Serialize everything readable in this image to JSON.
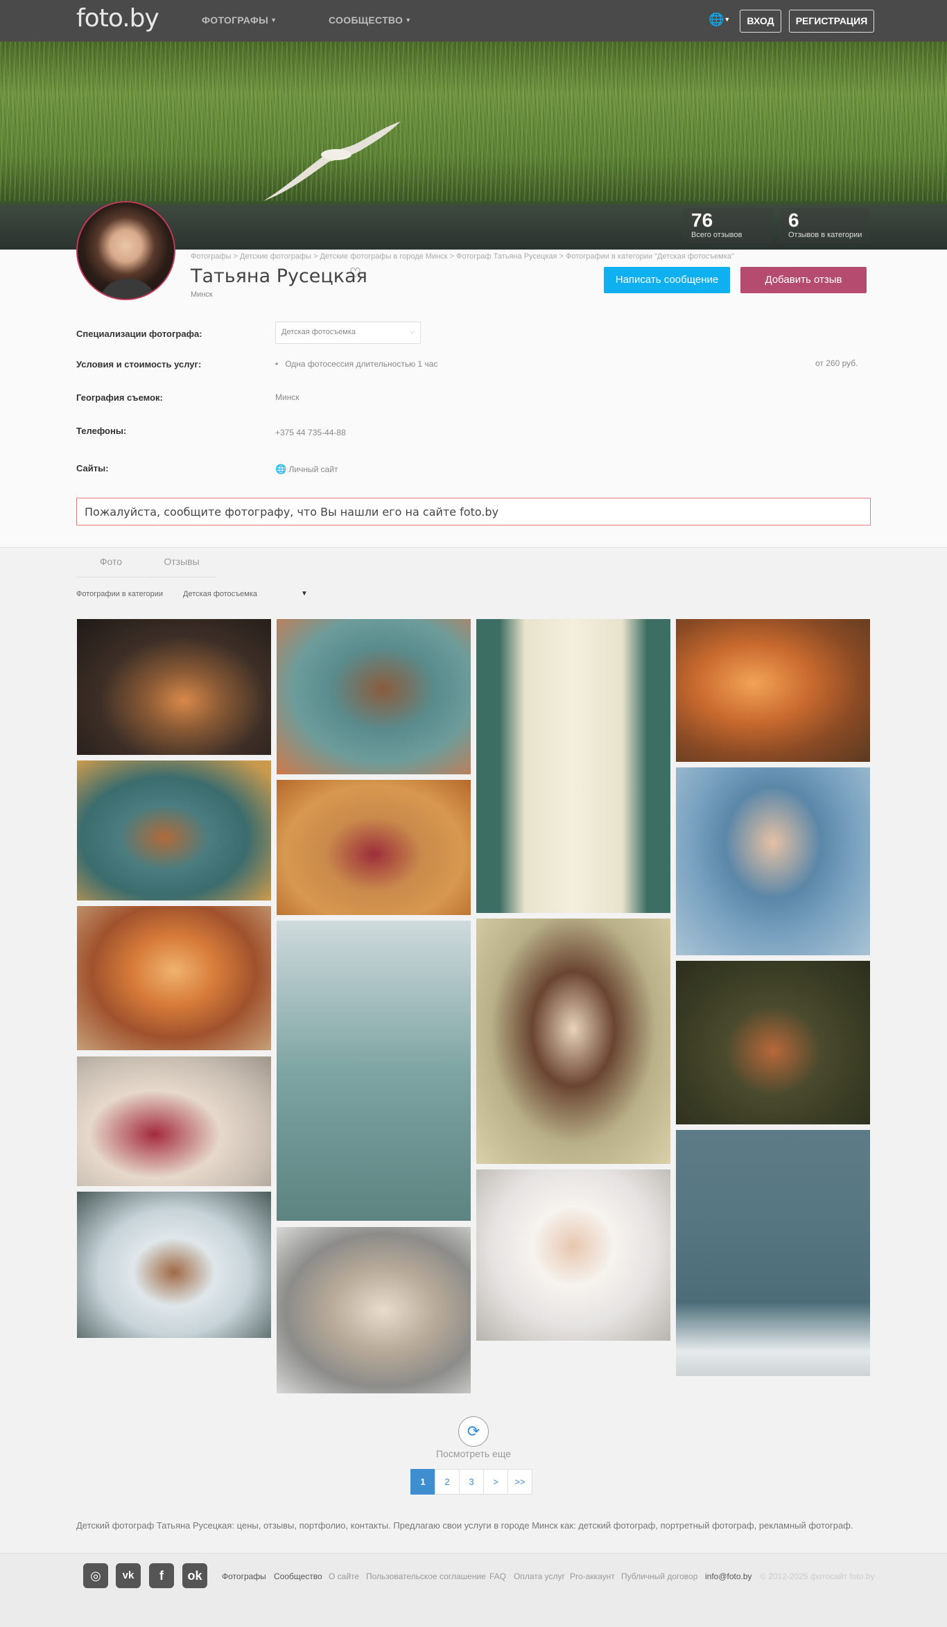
{
  "header": {
    "logo": "foto.by",
    "nav": [
      {
        "label": "ФОТОГРАФЫ"
      },
      {
        "label": "СООБЩЕСТВО"
      }
    ],
    "login_label": "ВХОД",
    "register_label": "РЕГИСТРАЦИЯ"
  },
  "hero": {
    "stats": [
      {
        "value": "76",
        "label": "Всего отзывов"
      },
      {
        "value": "6",
        "label": "Отзывов в категории"
      }
    ]
  },
  "profile": {
    "breadcrumb": "Фотографы > Детские фотографы > Детские фотографы в городе Минск > Фотограф Татьяна Русецкая > Фотографии в категории \"Детская фотосъемка\"",
    "name": "Татьяна Русецкая",
    "city": "Минск",
    "message_button": "Написать сообщение",
    "review_button": "Добавить отзыв"
  },
  "info": {
    "spec_label": "Специализации фотографа:",
    "spec_value": "Детская фотосъемка",
    "terms_label": "Условия и стоимость услуг:",
    "terms_item": "Одна фотосессия длительностью 1 час",
    "terms_price": "от 260 руб.",
    "geo_label": "География съемок:",
    "geo_value": "Минск",
    "phones_label": "Телефоны:",
    "phone": "+375 44 735-44-88",
    "sites_label": "Сайты:",
    "site": "Личный сайт"
  },
  "notice": "Пожалуйста, сообщите фотографу, что Вы нашли его на сайте foto.by",
  "tabs": [
    {
      "label": "Фото"
    },
    {
      "label": "Отзывы"
    }
  ],
  "filter": {
    "label": "Фотографии в категории",
    "value": "Детская фотосъемка"
  },
  "load_more": "Посмотреть еще",
  "pagination": [
    "1",
    "2",
    "3",
    ">",
    ">>"
  ],
  "seo_text": "Детский фотограф Татьяна Русецкая: цены, отзывы, портфолио, контакты. Предлагаю свои услуги в городе Минск как: детский фотограф, портретный фотограф, рекламный фотограф.",
  "footer": {
    "links": [
      "Фотографы",
      "Сообщество",
      "О сайте",
      "Пользовательское соглашение",
      "FAQ",
      "Оплата услуг",
      "Pro-аккаунт",
      "Публичный договор",
      "info@foto.by"
    ],
    "copyright": "© 2012-2025 фотосайт foto.by"
  }
}
